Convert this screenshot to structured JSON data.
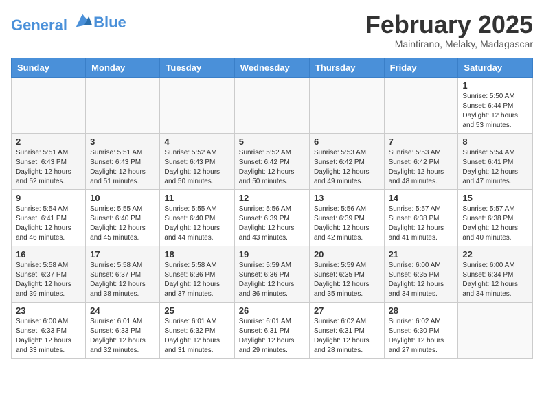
{
  "header": {
    "logo_line1": "General",
    "logo_line2": "Blue",
    "month_title": "February 2025",
    "location": "Maintirano, Melaky, Madagascar"
  },
  "weekdays": [
    "Sunday",
    "Monday",
    "Tuesday",
    "Wednesday",
    "Thursday",
    "Friday",
    "Saturday"
  ],
  "weeks": [
    [
      {
        "day": "",
        "info": ""
      },
      {
        "day": "",
        "info": ""
      },
      {
        "day": "",
        "info": ""
      },
      {
        "day": "",
        "info": ""
      },
      {
        "day": "",
        "info": ""
      },
      {
        "day": "",
        "info": ""
      },
      {
        "day": "1",
        "info": "Sunrise: 5:50 AM\nSunset: 6:44 PM\nDaylight: 12 hours\nand 53 minutes."
      }
    ],
    [
      {
        "day": "2",
        "info": "Sunrise: 5:51 AM\nSunset: 6:43 PM\nDaylight: 12 hours\nand 52 minutes."
      },
      {
        "day": "3",
        "info": "Sunrise: 5:51 AM\nSunset: 6:43 PM\nDaylight: 12 hours\nand 51 minutes."
      },
      {
        "day": "4",
        "info": "Sunrise: 5:52 AM\nSunset: 6:43 PM\nDaylight: 12 hours\nand 50 minutes."
      },
      {
        "day": "5",
        "info": "Sunrise: 5:52 AM\nSunset: 6:42 PM\nDaylight: 12 hours\nand 50 minutes."
      },
      {
        "day": "6",
        "info": "Sunrise: 5:53 AM\nSunset: 6:42 PM\nDaylight: 12 hours\nand 49 minutes."
      },
      {
        "day": "7",
        "info": "Sunrise: 5:53 AM\nSunset: 6:42 PM\nDaylight: 12 hours\nand 48 minutes."
      },
      {
        "day": "8",
        "info": "Sunrise: 5:54 AM\nSunset: 6:41 PM\nDaylight: 12 hours\nand 47 minutes."
      }
    ],
    [
      {
        "day": "9",
        "info": "Sunrise: 5:54 AM\nSunset: 6:41 PM\nDaylight: 12 hours\nand 46 minutes."
      },
      {
        "day": "10",
        "info": "Sunrise: 5:55 AM\nSunset: 6:40 PM\nDaylight: 12 hours\nand 45 minutes."
      },
      {
        "day": "11",
        "info": "Sunrise: 5:55 AM\nSunset: 6:40 PM\nDaylight: 12 hours\nand 44 minutes."
      },
      {
        "day": "12",
        "info": "Sunrise: 5:56 AM\nSunset: 6:39 PM\nDaylight: 12 hours\nand 43 minutes."
      },
      {
        "day": "13",
        "info": "Sunrise: 5:56 AM\nSunset: 6:39 PM\nDaylight: 12 hours\nand 42 minutes."
      },
      {
        "day": "14",
        "info": "Sunrise: 5:57 AM\nSunset: 6:38 PM\nDaylight: 12 hours\nand 41 minutes."
      },
      {
        "day": "15",
        "info": "Sunrise: 5:57 AM\nSunset: 6:38 PM\nDaylight: 12 hours\nand 40 minutes."
      }
    ],
    [
      {
        "day": "16",
        "info": "Sunrise: 5:58 AM\nSunset: 6:37 PM\nDaylight: 12 hours\nand 39 minutes."
      },
      {
        "day": "17",
        "info": "Sunrise: 5:58 AM\nSunset: 6:37 PM\nDaylight: 12 hours\nand 38 minutes."
      },
      {
        "day": "18",
        "info": "Sunrise: 5:58 AM\nSunset: 6:36 PM\nDaylight: 12 hours\nand 37 minutes."
      },
      {
        "day": "19",
        "info": "Sunrise: 5:59 AM\nSunset: 6:36 PM\nDaylight: 12 hours\nand 36 minutes."
      },
      {
        "day": "20",
        "info": "Sunrise: 5:59 AM\nSunset: 6:35 PM\nDaylight: 12 hours\nand 35 minutes."
      },
      {
        "day": "21",
        "info": "Sunrise: 6:00 AM\nSunset: 6:35 PM\nDaylight: 12 hours\nand 34 minutes."
      },
      {
        "day": "22",
        "info": "Sunrise: 6:00 AM\nSunset: 6:34 PM\nDaylight: 12 hours\nand 34 minutes."
      }
    ],
    [
      {
        "day": "23",
        "info": "Sunrise: 6:00 AM\nSunset: 6:33 PM\nDaylight: 12 hours\nand 33 minutes."
      },
      {
        "day": "24",
        "info": "Sunrise: 6:01 AM\nSunset: 6:33 PM\nDaylight: 12 hours\nand 32 minutes."
      },
      {
        "day": "25",
        "info": "Sunrise: 6:01 AM\nSunset: 6:32 PM\nDaylight: 12 hours\nand 31 minutes."
      },
      {
        "day": "26",
        "info": "Sunrise: 6:01 AM\nSunset: 6:31 PM\nDaylight: 12 hours\nand 29 minutes."
      },
      {
        "day": "27",
        "info": "Sunrise: 6:02 AM\nSunset: 6:31 PM\nDaylight: 12 hours\nand 28 minutes."
      },
      {
        "day": "28",
        "info": "Sunrise: 6:02 AM\nSunset: 6:30 PM\nDaylight: 12 hours\nand 27 minutes."
      },
      {
        "day": "",
        "info": ""
      }
    ]
  ]
}
